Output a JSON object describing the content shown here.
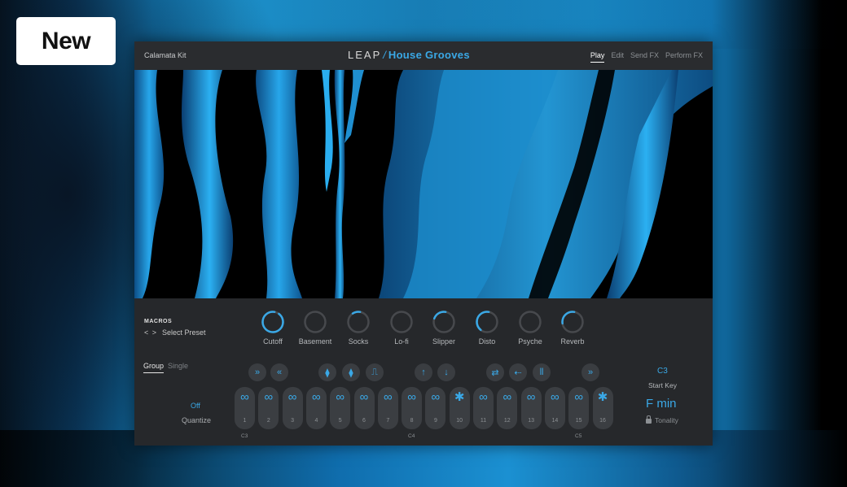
{
  "badge": "New",
  "header": {
    "kit_name": "Calamata Kit",
    "brand_leap": "LEAP",
    "brand_sep": "/",
    "brand_product": "House Grooves",
    "nav": [
      "Play",
      "Edit",
      "Send FX",
      "Perform FX"
    ],
    "nav_active": "Play"
  },
  "macros": {
    "title": "MACROS",
    "preset_arrows": "< >",
    "preset_label": "Select Preset",
    "knobs": [
      {
        "label": "Cutoff",
        "value": 0.92
      },
      {
        "label": "Basement",
        "value": 0.0
      },
      {
        "label": "Socks",
        "value": 0.12
      },
      {
        "label": "Lo-fi",
        "value": 0.0
      },
      {
        "label": "Slipper",
        "value": 0.22
      },
      {
        "label": "Disto",
        "value": 0.42
      },
      {
        "label": "Psyche",
        "value": 0.0
      },
      {
        "label": "Reverb",
        "value": 0.3
      }
    ]
  },
  "mode_tabs": {
    "group": "Group",
    "single": "Single"
  },
  "quantize": {
    "value": "Off",
    "label": "Quantize"
  },
  "fx_buttons": [
    "fast-forward",
    "rewind",
    "stutter",
    "stutter-alt",
    "filter",
    "pitch-up",
    "pitch-down",
    "swap",
    "reverse",
    "chop",
    "fast-forward-2"
  ],
  "pads": [
    "1",
    "2",
    "3",
    "4",
    "5",
    "6",
    "7",
    "8",
    "9",
    "10",
    "11",
    "12",
    "13",
    "14",
    "15",
    "16"
  ],
  "pad_icons": [
    "loop",
    "loop",
    "loop",
    "loop",
    "loop",
    "loop",
    "loop",
    "loop",
    "loop",
    "oneshot",
    "loop",
    "loop",
    "loop",
    "loop",
    "loop",
    "oneshot"
  ],
  "note_labels": [
    "C3",
    "C4",
    "C5"
  ],
  "start_key": {
    "value": "C3",
    "label": "Start Key"
  },
  "tonality": {
    "value": "F  min",
    "label": "Tonality"
  },
  "colors": {
    "accent": "#3aa8e6",
    "panel": "#26282b",
    "pad": "#3b3e42"
  }
}
